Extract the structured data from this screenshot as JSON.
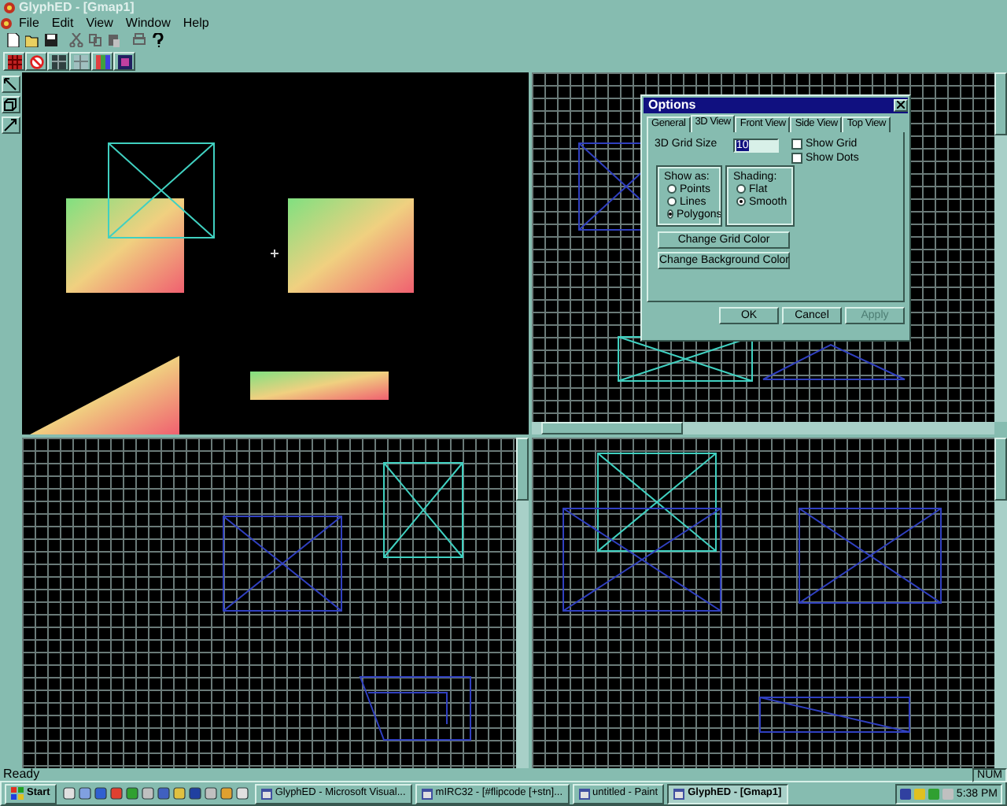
{
  "window": {
    "title": "GlyphED - [Gmap1]"
  },
  "menu": [
    "File",
    "Edit",
    "View",
    "Window",
    "Help"
  ],
  "dialog": {
    "title": "Options",
    "tabs": [
      {
        "label": "General",
        "selected": false
      },
      {
        "label": "3D View",
        "selected": true
      },
      {
        "label": "Front View",
        "selected": false
      },
      {
        "label": "Side View",
        "selected": false
      },
      {
        "label": "Top View",
        "selected": false
      }
    ],
    "grid_size": {
      "label": "3D Grid Size",
      "value": "10"
    },
    "checkboxes": [
      {
        "label": "Show Grid",
        "checked": false
      },
      {
        "label": "Show Dots",
        "checked": false
      }
    ],
    "show_as": {
      "title": "Show as:",
      "options": [
        {
          "label": "Points",
          "selected": false
        },
        {
          "label": "Lines",
          "selected": false
        },
        {
          "label": "Polygons",
          "selected": true
        }
      ]
    },
    "shading": {
      "title": "Shading:",
      "options": [
        {
          "label": "Flat",
          "selected": false
        },
        {
          "label": "Smooth",
          "selected": true
        }
      ]
    },
    "color_buttons": [
      "Change Grid Color",
      "Change Background Color"
    ],
    "buttons": [
      {
        "label": "OK",
        "disabled": false
      },
      {
        "label": "Cancel",
        "disabled": false
      },
      {
        "label": "Apply",
        "disabled": true
      }
    ]
  },
  "status_bar": {
    "text": "Ready",
    "num": "NUM"
  },
  "taskbar": {
    "start": "Start",
    "tasks": [
      {
        "label": "GlyphED - Microsoft Visual...",
        "selected": false
      },
      {
        "label": "mIRC32 - [#flipcode [+stn]...",
        "selected": false
      },
      {
        "label": "untitled - Paint",
        "selected": false
      },
      {
        "label": "GlyphED - [Gmap1]",
        "selected": true
      }
    ],
    "clock": "5:38 PM"
  }
}
